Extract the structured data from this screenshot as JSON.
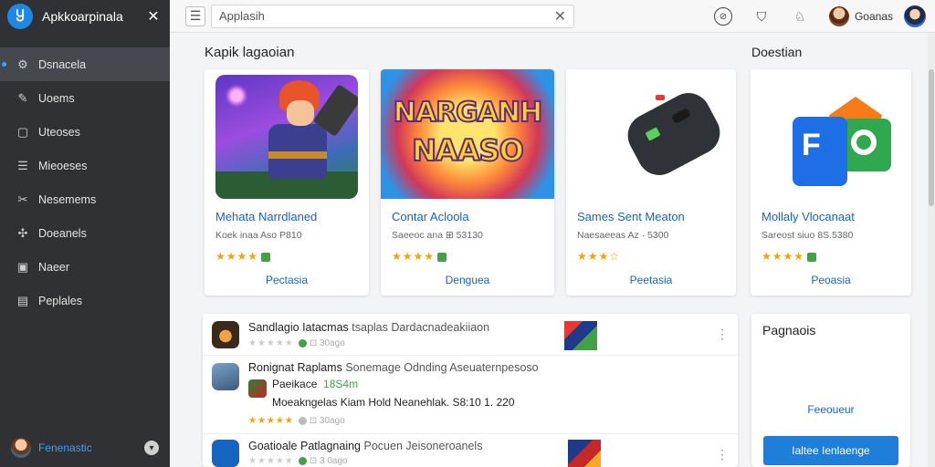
{
  "app": {
    "title": "Apkkoarpinala",
    "logo_glyph": "Ⴘ"
  },
  "sidebar": {
    "items": [
      {
        "label": "Dsnacela",
        "icon": "gear-icon",
        "glyph": "⚙",
        "active": true
      },
      {
        "label": "Uoems",
        "icon": "pen-icon",
        "glyph": "✎",
        "active": false
      },
      {
        "label": "Uteoses",
        "icon": "window-icon",
        "glyph": "▢",
        "active": false
      },
      {
        "label": "Mieoeses",
        "icon": "list-icon",
        "glyph": "☰",
        "active": false
      },
      {
        "label": "Nesemems",
        "icon": "wrench-icon",
        "glyph": "✂",
        "active": false
      },
      {
        "label": "Doeanels",
        "icon": "puzzle-icon",
        "glyph": "✣",
        "active": false
      },
      {
        "label": "Naeer",
        "icon": "gamepad-icon",
        "glyph": "▣",
        "active": false
      },
      {
        "label": "Peplales",
        "icon": "book-icon",
        "glyph": "▤",
        "active": false
      }
    ],
    "user": {
      "name": "Fenenastic"
    }
  },
  "topbar": {
    "search": {
      "value": "Applasih",
      "placeholder": "Applasih"
    },
    "user_name": "Goanas"
  },
  "featured": {
    "title": "Kapik lagaoian",
    "cards": [
      {
        "name": "Mehata Narrdlaned",
        "sub": "Koek inaa Aso P810",
        "stars": "★★★★",
        "button": "Pectasia"
      },
      {
        "name": "Contar Acloola",
        "sub": "Saeeoc ana ⊞ 53130",
        "stars": "★★★★",
        "button": "Denguea",
        "art_line1": "NARGANH",
        "art_line2": "NAASO"
      },
      {
        "name": "Sames Sent Meaton",
        "sub": "Naesaeeas Az · 5300",
        "stars": "★★★☆",
        "button": "Peetasia"
      },
      {
        "name": "Mollaly Vlocanaat",
        "sub": "Sareost siuo 8S.5380",
        "stars": "★★★★",
        "button": "Peoasia"
      }
    ]
  },
  "side": {
    "title": "Doestian"
  },
  "list": {
    "items": [
      {
        "title": "Sandlagio Iatacmas",
        "desc": "tsaplas Dardacnadeakiiaon",
        "stars": "★★★★★",
        "meta": "⊡ 30ago"
      },
      {
        "title": "Ronignat Raplams",
        "desc": "Sonemage Odnding Aseuaternpesoso",
        "stars": "★★★★★",
        "meta": "⊡ 30ago",
        "sub1_name": "Paeikace",
        "sub1_value": "18S4m",
        "sub2": "Moeakngelas Kiam Hold Neanehlak. S8:10 1. 220"
      },
      {
        "title": "Goatioale Patlagnaing",
        "desc": "Pocuen Jeisoneroanels",
        "stars": "★★★★★",
        "meta": "⊡ 3 0ago"
      }
    ]
  },
  "right_panel": {
    "title": "Pagnaois",
    "link": "Feeoueur",
    "button": "Ialtee Ienlaenge"
  }
}
